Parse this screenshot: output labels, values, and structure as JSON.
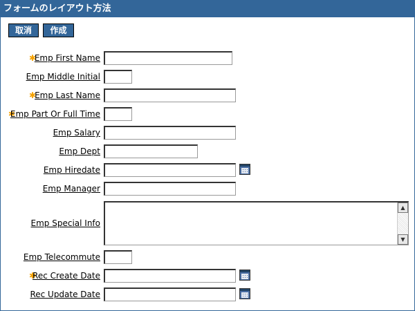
{
  "title": "フォームのレイアウト方法",
  "buttons": {
    "cancel": "取消",
    "create": "作成"
  },
  "fields": [
    {
      "label": "Emp First Name",
      "required": true
    },
    {
      "label": "Emp Middle Initial",
      "required": false
    },
    {
      "label": "Emp Last Name",
      "required": true
    },
    {
      "label": "Emp Part Or Full Time",
      "required": true
    },
    {
      "label": "Emp Salary",
      "required": false
    },
    {
      "label": "Emp Dept",
      "required": false
    },
    {
      "label": "Emp Hiredate",
      "required": false
    },
    {
      "label": "Emp Manager",
      "required": false
    },
    {
      "label": "Emp Special Info",
      "required": false
    },
    {
      "label": "Emp Telecommute",
      "required": false
    },
    {
      "label": "Rec Create Date",
      "required": true
    },
    {
      "label": "Rec Update Date",
      "required": false
    }
  ],
  "colors": {
    "header": "#336699",
    "required_star": "#f5a100"
  },
  "icons": {
    "calendar": "calendar-icon",
    "required": "required-star-icon",
    "scroll_up": "scroll-up-icon",
    "scroll_down": "scroll-down-icon"
  }
}
